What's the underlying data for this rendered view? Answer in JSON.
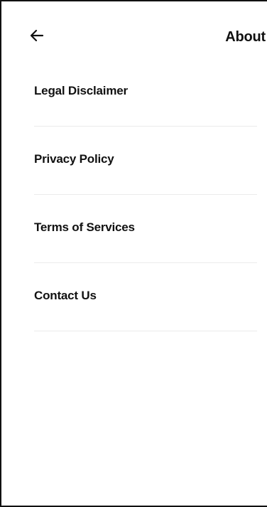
{
  "header": {
    "title": "About",
    "back_icon": "arrow-left-icon"
  },
  "menu": {
    "items": [
      {
        "label": "Legal Disclaimer"
      },
      {
        "label": "Privacy Policy"
      },
      {
        "label": "Terms of Services"
      },
      {
        "label": "Contact Us"
      }
    ]
  },
  "colors": {
    "text": "#111111",
    "divider": "#ebebeb",
    "background": "#ffffff"
  }
}
